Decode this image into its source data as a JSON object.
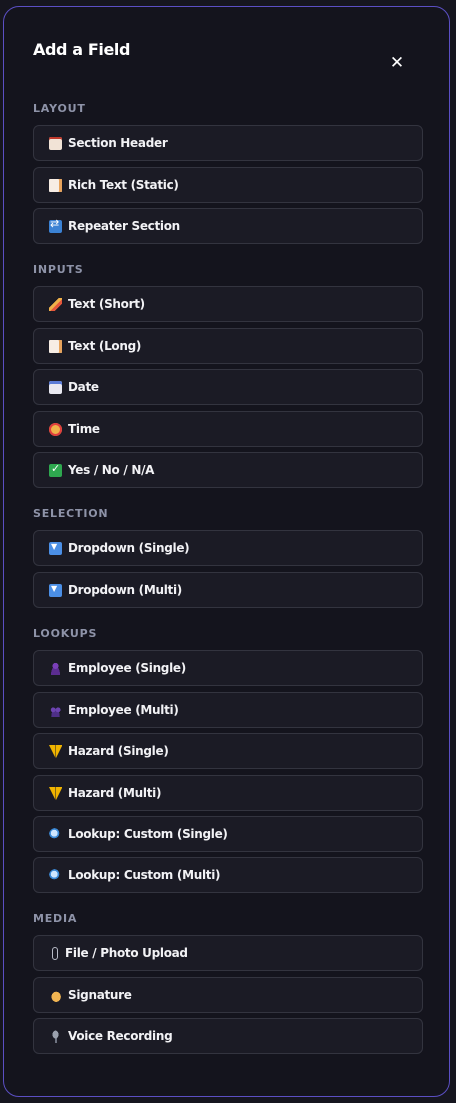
{
  "panel": {
    "title": "Add a Field",
    "close_label": "✕"
  },
  "sections": [
    {
      "label": "LAYOUT",
      "items": [
        {
          "label": "Section Header",
          "icon": "section-header-icon"
        },
        {
          "label": "Rich Text (Static)",
          "icon": "rich-text-icon"
        },
        {
          "label": "Repeater Section",
          "icon": "repeat-icon"
        }
      ]
    },
    {
      "label": "INPUTS",
      "items": [
        {
          "label": "Text (Short)",
          "icon": "pencil-icon"
        },
        {
          "label": "Text (Long)",
          "icon": "memo-icon"
        },
        {
          "label": "Date",
          "icon": "calendar-icon"
        },
        {
          "label": "Time",
          "icon": "alarm-clock-icon"
        },
        {
          "label": "Yes / No / N/A",
          "icon": "checkmark-icon"
        }
      ]
    },
    {
      "label": "SELECTION",
      "items": [
        {
          "label": "Dropdown (Single)",
          "icon": "dropdown-icon"
        },
        {
          "label": "Dropdown (Multi)",
          "icon": "dropdown-icon"
        }
      ]
    },
    {
      "label": "LOOKUPS",
      "items": [
        {
          "label": "Employee (Single)",
          "icon": "person-icon"
        },
        {
          "label": "Employee (Multi)",
          "icon": "people-icon"
        },
        {
          "label": "Hazard (Single)",
          "icon": "warning-icon"
        },
        {
          "label": "Hazard (Multi)",
          "icon": "warning-icon"
        },
        {
          "label": "Lookup: Custom (Single)",
          "icon": "magnifier-icon"
        },
        {
          "label": "Lookup: Custom (Multi)",
          "icon": "magnifier-icon"
        }
      ]
    },
    {
      "label": "MEDIA",
      "items": [
        {
          "label": "File / Photo Upload",
          "icon": "paperclip-icon"
        },
        {
          "label": "Signature",
          "icon": "writing-hand-icon"
        },
        {
          "label": "Voice Recording",
          "icon": "microphone-icon"
        }
      ]
    }
  ],
  "colors": {
    "background": "#14141d",
    "border_accent": "#5b4fc4",
    "item_background": "#1b1b25",
    "section_label": "#8e93a8"
  }
}
